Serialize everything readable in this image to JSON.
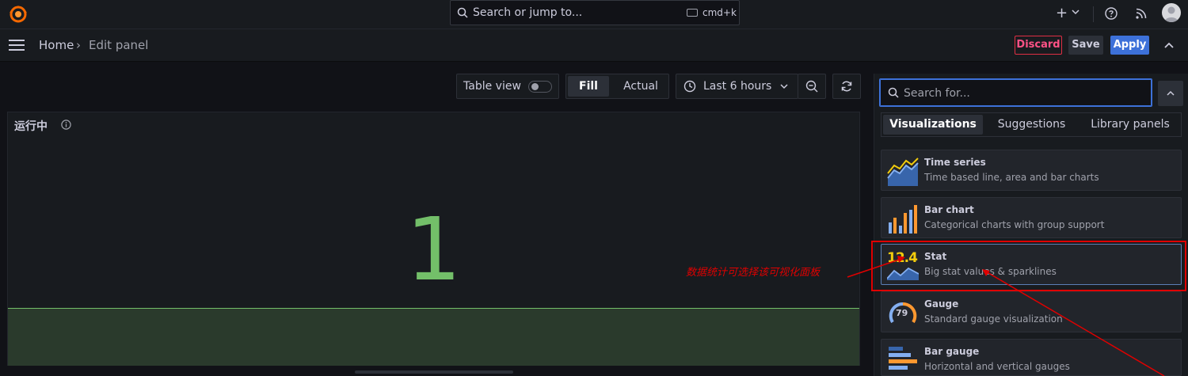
{
  "topbar": {
    "search_placeholder": "Search or jump to...",
    "shortcut": "cmd+k",
    "plus": "+"
  },
  "nav": {
    "breadcrumb": [
      "Home",
      "Edit panel"
    ],
    "breadcrumb_sep": "›",
    "discard": "Discard",
    "save": "Save",
    "apply": "Apply"
  },
  "toolbar": {
    "table_view": "Table view",
    "fill": "Fill",
    "actual": "Actual",
    "time_range": "Last 6 hours"
  },
  "panel": {
    "title": "运行中",
    "value": "1",
    "value_color": "#73bf69"
  },
  "sidebar": {
    "search_placeholder": "Search for...",
    "tabs": [
      "Visualizations",
      "Suggestions",
      "Library panels"
    ],
    "visualizations": [
      {
        "title": "Time series",
        "desc": "Time based line, area and bar charts",
        "icon": "time-series-icon"
      },
      {
        "title": "Bar chart",
        "desc": "Categorical charts with group support",
        "icon": "bar-chart-icon"
      },
      {
        "title": "Stat",
        "desc": "Big stat values & sparklines",
        "icon": "stat-icon",
        "icon_text": "12.4"
      },
      {
        "title": "Gauge",
        "desc": "Standard gauge visualization",
        "icon": "gauge-icon",
        "icon_text": "79"
      },
      {
        "title": "Bar gauge",
        "desc": "Horizontal and vertical gauges",
        "icon": "bar-gauge-icon"
      }
    ]
  },
  "annotation": {
    "text": "数据统计可选择该可视化面板",
    "color": "#e00000"
  }
}
